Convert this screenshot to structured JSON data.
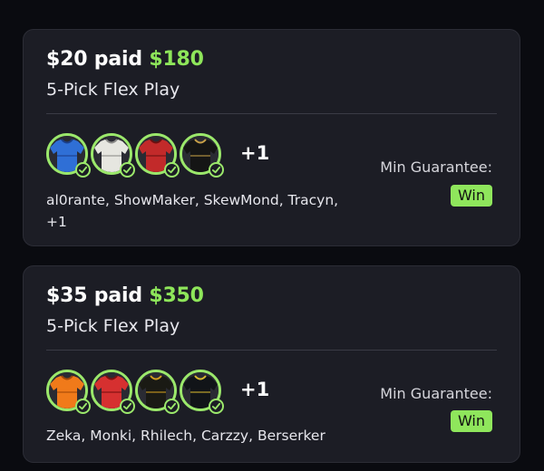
{
  "colors": {
    "accent": "#8ee65a",
    "card_bg": "#1c1d25",
    "page_bg": "#0a0b10"
  },
  "cards": [
    {
      "paid_amount": "$20 paid",
      "payout": "$180",
      "play_type": "5-Pick Flex Play",
      "jerseys": [
        {
          "name": "blue-jersey-icon",
          "color": "#2f6fd6",
          "trim": "#1a3f8a"
        },
        {
          "name": "white-jersey-icon",
          "color": "#e6e6e0",
          "trim": "#8a8a88"
        },
        {
          "name": "red-jersey-icon",
          "color": "#c22a2a",
          "trim": "#6a1010"
        },
        {
          "name": "black-jersey-icon",
          "color": "#151515",
          "trim": "#c8a048"
        }
      ],
      "extra_count": "+1",
      "players": "al0rante, ShowMaker, SkewMond, Tracyn,\n+1",
      "min_guarantee_label": "Min Guarantee:",
      "min_guarantee_value": "Win"
    },
    {
      "paid_amount": "$35 paid",
      "payout": "$350",
      "play_type": "5-Pick Flex Play",
      "jerseys": [
        {
          "name": "orange-jersey-icon",
          "color": "#f07a1a",
          "trim": "#a04808"
        },
        {
          "name": "red-jersey-icon",
          "color": "#d63030",
          "trim": "#7a1010"
        },
        {
          "name": "black-gold-jersey-icon",
          "color": "#1a1a14",
          "trim": "#d4a020"
        },
        {
          "name": "black-jersey-icon",
          "color": "#111418",
          "trim": "#d8b830"
        }
      ],
      "extra_count": "+1",
      "players": "Zeka, Monki, Rhilech, Carzzy, Berserker",
      "min_guarantee_label": "Min Guarantee:",
      "min_guarantee_value": "Win"
    }
  ]
}
